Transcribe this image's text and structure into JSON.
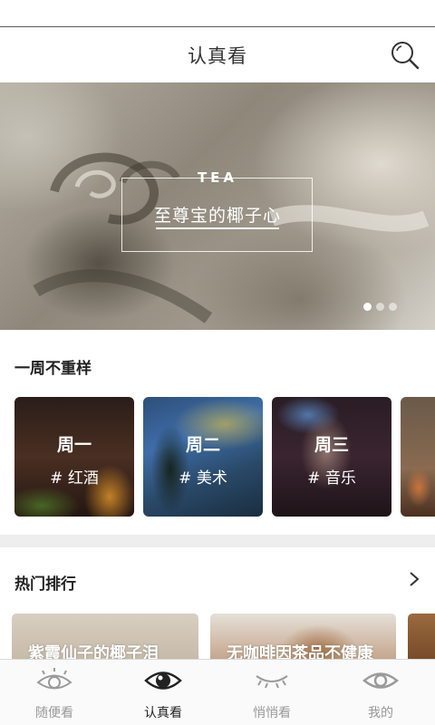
{
  "header": {
    "title": "认真看"
  },
  "banner": {
    "label": "TEA",
    "title": "至尊宝的椰子心",
    "dots": 3,
    "active_dot": 0
  },
  "weekly": {
    "title": "一周不重样",
    "cards": [
      {
        "day": "周一",
        "tag": "# 红酒"
      },
      {
        "day": "周二",
        "tag": "# 美术"
      },
      {
        "day": "周三",
        "tag": "# 音乐"
      },
      {
        "day": "",
        "tag": ""
      }
    ]
  },
  "ranking": {
    "title": "热门排行",
    "items": [
      {
        "title": "紫霞仙子的椰子泪"
      },
      {
        "title": "无咖啡因茶品不健康"
      },
      {
        "title": ""
      }
    ]
  },
  "tabs": [
    {
      "label": "随便看",
      "icon": "eye-outline-icon",
      "active": false
    },
    {
      "label": "认真看",
      "icon": "eye-filled-icon",
      "active": true
    },
    {
      "label": "悄悄看",
      "icon": "eye-closed-icon",
      "active": false
    },
    {
      "label": "我的",
      "icon": "eye-simple-icon",
      "active": false
    }
  ],
  "colors": {
    "accent": "#222222",
    "inactive_tab": "#999999",
    "divider": "#eeeeee"
  }
}
